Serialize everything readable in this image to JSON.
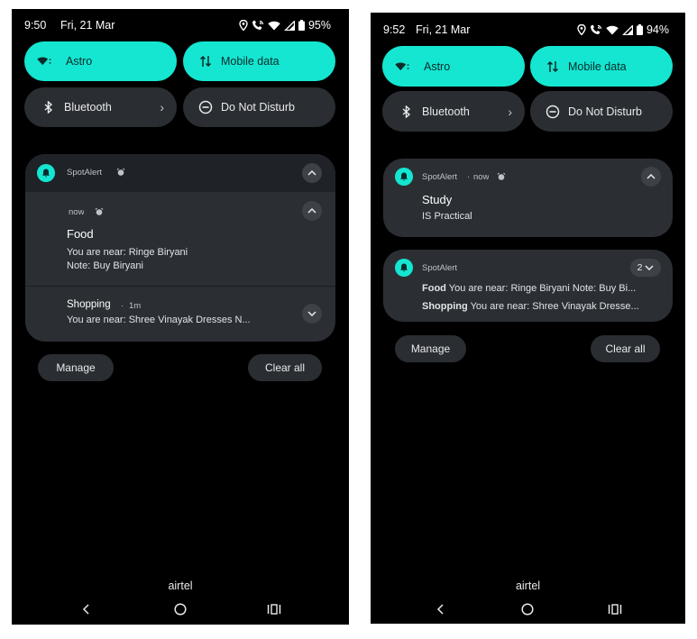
{
  "left_screen": {
    "status": {
      "time": "9:50",
      "date": "Fri, 21 Mar",
      "battery": "95%"
    },
    "tiles": {
      "wifi": {
        "label": "Astro",
        "state": "on"
      },
      "mobile": {
        "label": "Mobile data",
        "state": "on"
      },
      "bluetooth": {
        "label": "Bluetooth",
        "state": "off"
      },
      "dnd": {
        "label": "Do Not Disturb",
        "state": "off"
      }
    },
    "group": {
      "app": "SpotAlert",
      "expanded": {
        "time": "now",
        "title": "Food",
        "line1": "You are near: Ringe Biryani",
        "line2": "Note: Buy Biryani"
      },
      "collapsed": {
        "title": "Shopping",
        "time": "1m",
        "line1": "You are near: Shree Vinayak Dresses N..."
      }
    },
    "manage": "Manage",
    "clear_all": "Clear all",
    "carrier": "airtel"
  },
  "right_screen": {
    "status": {
      "time": "9:52",
      "date": "Fri, 21 Mar",
      "battery": "94%"
    },
    "tiles": {
      "wifi": {
        "label": "Astro",
        "state": "on"
      },
      "mobile": {
        "label": "Mobile data",
        "state": "on"
      },
      "bluetooth": {
        "label": "Bluetooth",
        "state": "off"
      },
      "dnd": {
        "label": "Do Not Disturb",
        "state": "off"
      }
    },
    "single_notif": {
      "app": "SpotAlert",
      "time": "now",
      "title": "Study",
      "body": "IS Practical"
    },
    "group": {
      "app": "SpotAlert",
      "count": "2",
      "rows": [
        {
          "title": "Food",
          "text": "You are near: Ringe Biryani Note: Buy Bi..."
        },
        {
          "title": "Shopping",
          "text": "You are near: Shree Vinayak Dresse..."
        }
      ]
    },
    "manage": "Manage",
    "clear_all": "Clear all",
    "carrier": "airtel"
  },
  "colors": {
    "accent": "#14e6d1",
    "card": "#2b2f34",
    "tile_off": "#2a2d31",
    "background": "#000000"
  },
  "icons": {
    "status": [
      "location-icon",
      "wifi-calling-icon",
      "wifi-icon",
      "signal-icon",
      "battery-icon"
    ],
    "tiles": [
      "wifi-icon",
      "mobile-data-icon",
      "bluetooth-icon",
      "dnd-icon"
    ],
    "nav": [
      "back-icon",
      "home-icon",
      "recents-icon"
    ]
  }
}
